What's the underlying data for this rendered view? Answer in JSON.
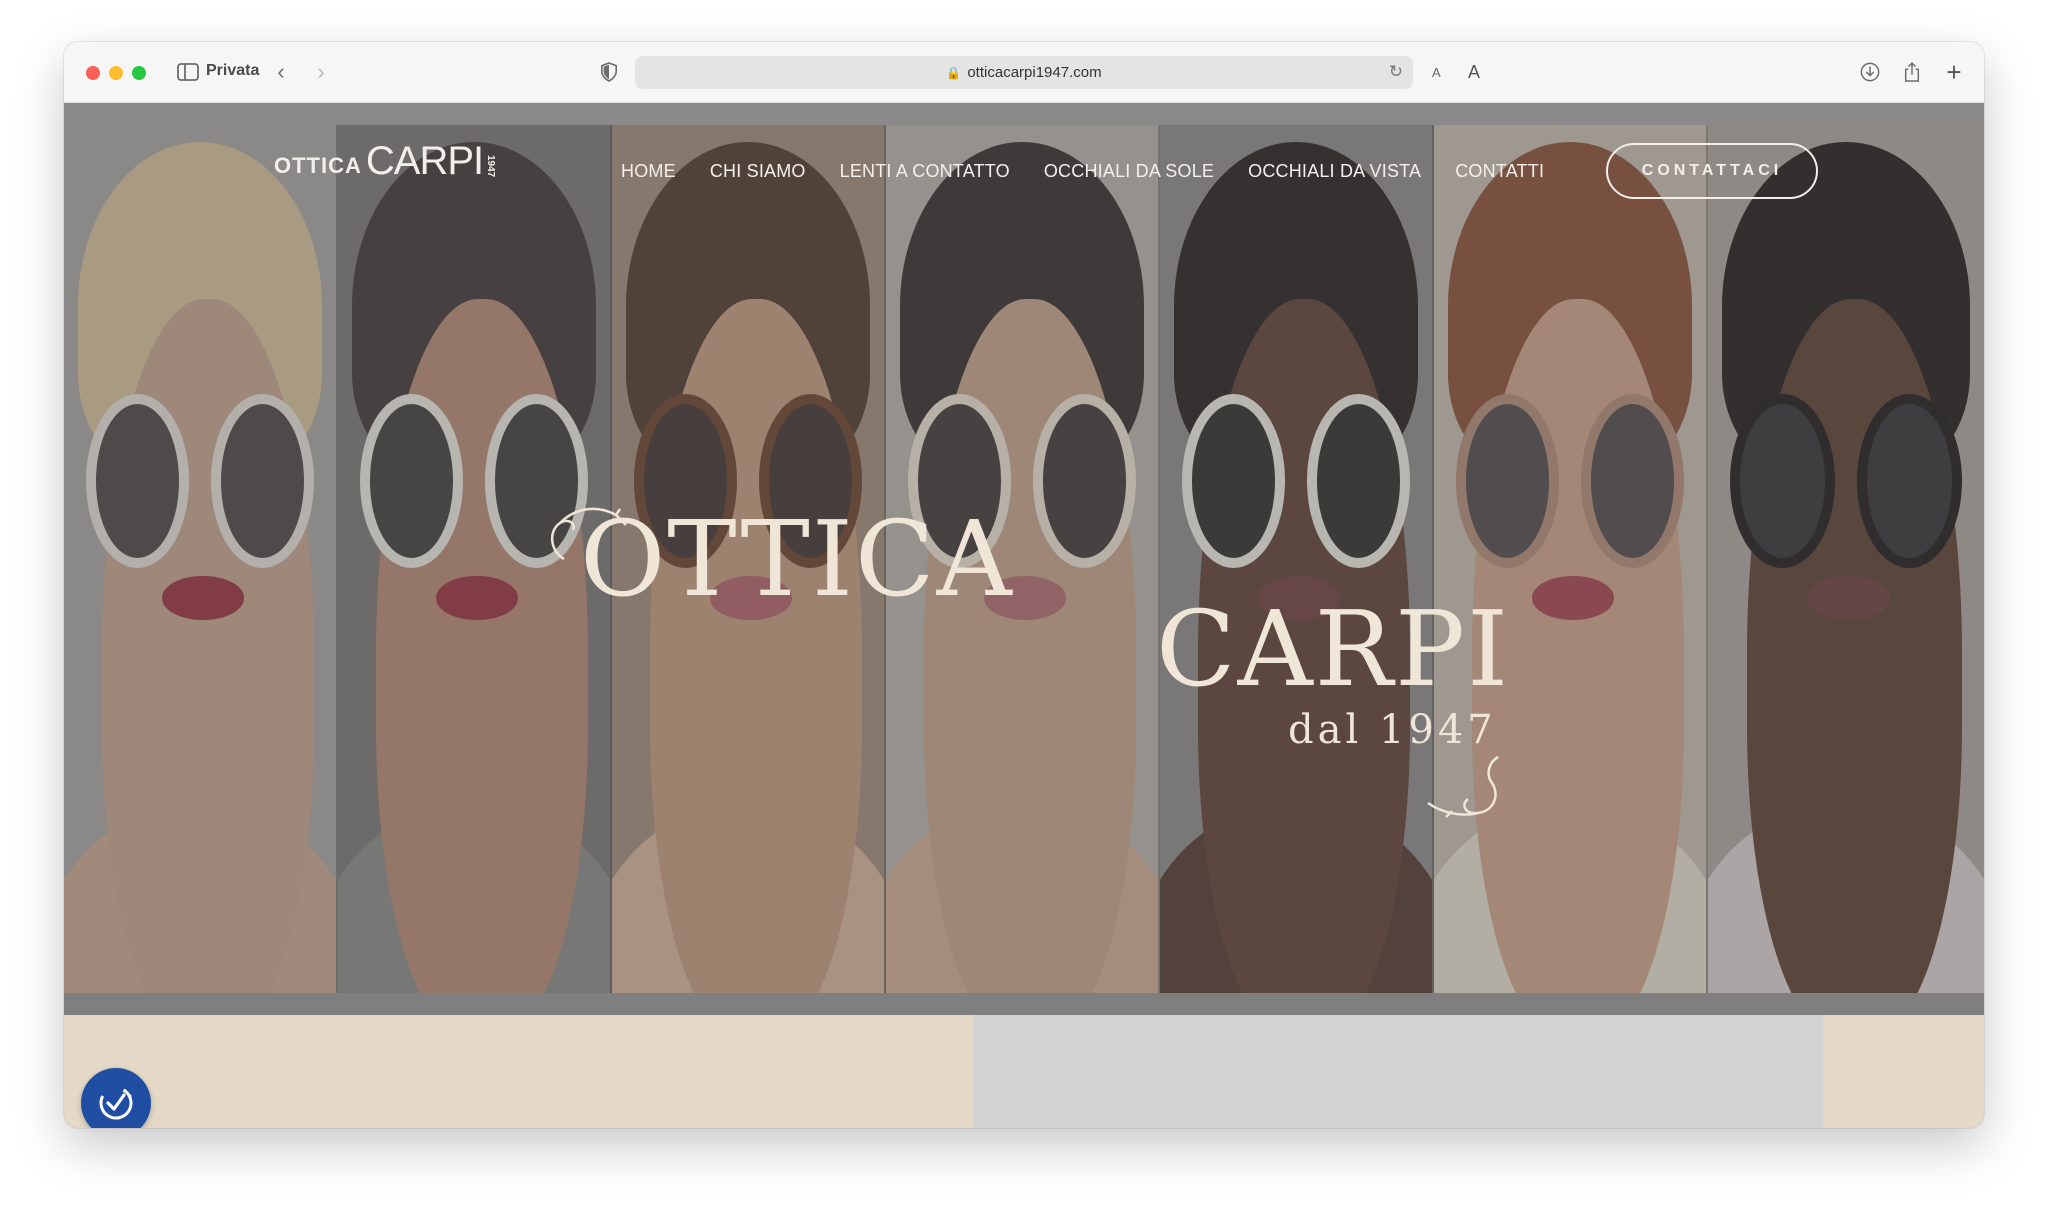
{
  "browser": {
    "mode_label": "Privata",
    "url": "otticacarpi1947.com",
    "font_small_label": "A",
    "font_large_label": "A"
  },
  "site": {
    "logo": {
      "ottica": "OTTICA",
      "carpi": "CARPI",
      "year": "1947"
    },
    "nav": [
      "HOME",
      "CHI SIAMO",
      "LENTI A CONTATTO",
      "OCCHIALI DA SOLE",
      "OCCHIALI DA VISTA",
      "CONTATTI"
    ],
    "cta_label": "CONTATTACI"
  },
  "hero": {
    "title_line1": "OTTICA",
    "title_line2": "CARPI",
    "subtitle": "dal 1947",
    "panels": [
      {
        "skin": "#c9a58e",
        "hair": "#d9c49b",
        "frame": "#ebe6dd",
        "lens": "#4a4242",
        "lips": "#9c2a3a",
        "shoulder": "#caa992",
        "bg": "#a9a6a3"
      },
      {
        "skin": "#b98a72",
        "hair": "#3b3231",
        "frame": "#f1ede5",
        "lens": "#3d3838",
        "lips": "#9a2b3b",
        "shoulder": "#8a8a88",
        "bg": "#7a7574"
      },
      {
        "skin": "#c89b7e",
        "hair": "#4c3426",
        "frame": "#6a3c26",
        "lens": "#3a302c",
        "lips": "#b3606a",
        "shoulder": "#d8b59a",
        "bg": "#a48b79"
      },
      {
        "skin": "#caa48a",
        "hair": "#2e2826",
        "frame": "#efe6d6",
        "lens": "#3a3533",
        "lips": "#b26b6f",
        "shoulder": "#d2ad94",
        "bg": "#bab3ab"
      },
      {
        "skin": "#5c3d2f",
        "hair": "#1d1917",
        "frame": "#f3efe6",
        "lens": "#2b2826",
        "lips": "#6e3a3a",
        "shoulder": "#4f342a",
        "bg": "#8d8a89"
      },
      {
        "skin": "#d3a48a",
        "hair": "#8a4b30",
        "frame": "#b48b74",
        "lens": "#4d4547",
        "lips": "#a8404c",
        "shoulder": "#e9e2d2",
        "bg": "#c9bfb3"
      },
      {
        "skin": "#5a3a2c",
        "hair": "#1b1514",
        "frame": "#151212",
        "lens": "#2e2c2f",
        "lips": "#6d3a3c",
        "shoulder": "#ddd3d6",
        "bg": "#b0a7a1"
      }
    ]
  },
  "colors": {
    "accent_cream": "#e4d9c6",
    "a11y_blue": "#1f4ea3"
  }
}
